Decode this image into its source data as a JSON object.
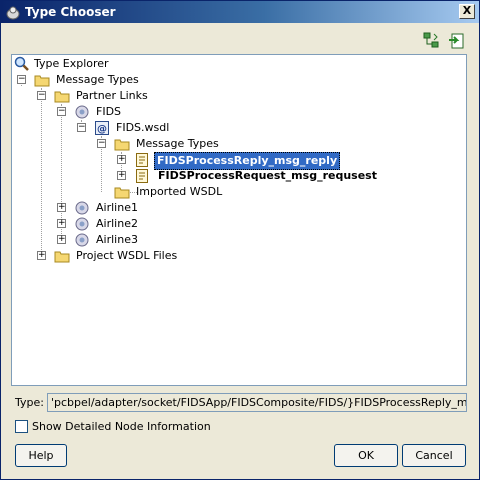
{
  "window": {
    "title": "Type Chooser",
    "close_label": "X"
  },
  "toolbar": {
    "buttons": [
      {
        "icon": "hierarchy-icon"
      },
      {
        "icon": "import-schema-icon"
      }
    ]
  },
  "tree": {
    "nodes": [
      {
        "label": "Type Explorer",
        "icon": "search-icon"
      },
      {
        "label": "Message Types",
        "icon": "folder-icon",
        "expander": "−"
      },
      {
        "label": "Partner Links",
        "icon": "folder-icon",
        "expander": "−"
      },
      {
        "label": "FIDS",
        "icon": "partner-link-icon",
        "expander": "−"
      },
      {
        "label": "FIDS.wsdl",
        "icon": "wsdl-icon",
        "expander": "−"
      },
      {
        "label": "Message Types",
        "icon": "folder-icon",
        "expander": "−"
      },
      {
        "label": "FIDSProcessReply_msg_reply",
        "icon": "message-icon",
        "expander": "+",
        "selected": true
      },
      {
        "label": "FIDSProcessRequest_msg_requsest",
        "icon": "message-icon",
        "expander": "+"
      },
      {
        "label": "Imported WSDL",
        "icon": "folder-icon"
      },
      {
        "label": "Airline1",
        "icon": "partner-link-icon",
        "expander": "+"
      },
      {
        "label": "Airline2",
        "icon": "partner-link-icon",
        "expander": "+"
      },
      {
        "label": "Airline3",
        "icon": "partner-link-icon",
        "expander": "+"
      },
      {
        "label": "Project WSDL Files",
        "icon": "folder-icon",
        "expander": "+"
      }
    ]
  },
  "type_field": {
    "label": "Type:",
    "value": "'pcbpel/adapter/socket/FIDSApp/FIDSComposite/FIDS/}FIDSProcessReply_msg_reply"
  },
  "options": {
    "show_detailed_label": "Show Detailed Node Information",
    "show_detailed_checked": false
  },
  "buttons": {
    "help": "Help",
    "ok": "OK",
    "cancel": "Cancel"
  },
  "colors": {
    "selection": "#316ac5",
    "title_bar": "#0a246a"
  }
}
